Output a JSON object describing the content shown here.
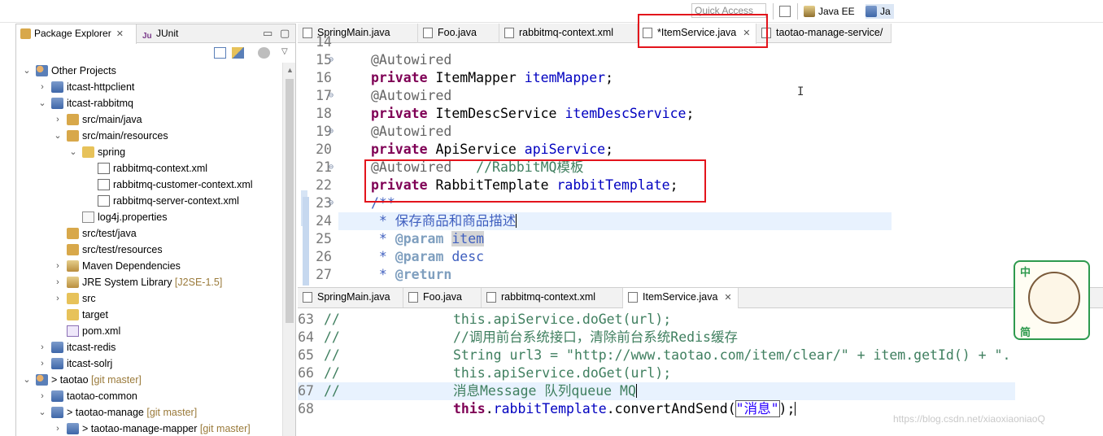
{
  "toolbar": {
    "quick_access": "Quick Access",
    "perspective_java_ee": "Java EE",
    "perspective_java": "Ja"
  },
  "explorer": {
    "tab_package_explorer": "Package Explorer",
    "tab_junit": "JUnit",
    "tree": [
      {
        "label": "Other Projects",
        "deco": "",
        "depth": 0,
        "twisty": "v",
        "icon": "people"
      },
      {
        "label": "itcast-httpclient",
        "deco": "",
        "depth": 1,
        "twisty": ">",
        "icon": "proj"
      },
      {
        "label": "itcast-rabbitmq",
        "deco": "",
        "depth": 1,
        "twisty": "v",
        "icon": "proj"
      },
      {
        "label": "src/main/java",
        "deco": "",
        "depth": 2,
        "twisty": ">",
        "icon": "pkgfolder"
      },
      {
        "label": "src/main/resources",
        "deco": "",
        "depth": 2,
        "twisty": "v",
        "icon": "pkgfolder"
      },
      {
        "label": "spring",
        "deco": "",
        "depth": 3,
        "twisty": "v",
        "icon": "folder"
      },
      {
        "label": "rabbitmq-context.xml",
        "deco": "",
        "depth": 4,
        "twisty": "",
        "icon": "xml"
      },
      {
        "label": "rabbitmq-customer-context.xml",
        "deco": "",
        "depth": 4,
        "twisty": "",
        "icon": "xml"
      },
      {
        "label": "rabbitmq-server-context.xml",
        "deco": "",
        "depth": 4,
        "twisty": "",
        "icon": "xml"
      },
      {
        "label": "log4j.properties",
        "deco": "",
        "depth": 3,
        "twisty": "",
        "icon": "file"
      },
      {
        "label": "src/test/java",
        "deco": "",
        "depth": 2,
        "twisty": "",
        "icon": "pkgfolder"
      },
      {
        "label": "src/test/resources",
        "deco": "",
        "depth": 2,
        "twisty": "",
        "icon": "pkgfolder"
      },
      {
        "label": "Maven Dependencies",
        "deco": "",
        "depth": 2,
        "twisty": ">",
        "icon": "lib"
      },
      {
        "label": "JRE System Library",
        "deco": " [J2SE-1.5]",
        "depth": 2,
        "twisty": ">",
        "icon": "lib"
      },
      {
        "label": "src",
        "deco": "",
        "depth": 2,
        "twisty": ">",
        "icon": "folder"
      },
      {
        "label": "target",
        "deco": "",
        "depth": 2,
        "twisty": "",
        "icon": "folder"
      },
      {
        "label": "pom.xml",
        "deco": "",
        "depth": 2,
        "twisty": "",
        "icon": "m"
      },
      {
        "label": "itcast-redis",
        "deco": "",
        "depth": 1,
        "twisty": ">",
        "icon": "proj"
      },
      {
        "label": "itcast-solrj",
        "deco": "",
        "depth": 1,
        "twisty": ">",
        "icon": "proj"
      },
      {
        "label": "> taotao",
        "deco": "  [git master]",
        "depth": 0,
        "twisty": "v",
        "icon": "people"
      },
      {
        "label": "taotao-common",
        "deco": "",
        "depth": 1,
        "twisty": ">",
        "icon": "proj"
      },
      {
        "label": "> taotao-manage",
        "deco": "  [git master]",
        "depth": 1,
        "twisty": "v",
        "icon": "proj"
      },
      {
        "label": "> taotao-manage-mapper",
        "deco": "  [git master]",
        "depth": 2,
        "twisty": ">",
        "icon": "proj"
      }
    ]
  },
  "editor_top": {
    "tabs": [
      "SpringMain.java",
      "Foo.java",
      "rabbitmq-context.xml",
      "*ItemService.java",
      "taotao-manage-service/"
    ],
    "active_tab": 3,
    "lines": [
      {
        "n": "14",
        "fold": false,
        "html": ""
      },
      {
        "n": "15",
        "fold": true,
        "html": "<span class=\"ann\">@Autowired</span>"
      },
      {
        "n": "16",
        "fold": false,
        "html": "<span class=\"kw\">private</span> ItemMapper <span class=\"fld\">itemMapper</span>;"
      },
      {
        "n": "17",
        "fold": true,
        "html": "<span class=\"ann\">@Autowired</span>"
      },
      {
        "n": "18",
        "fold": false,
        "html": "<span class=\"kw\">private</span> ItemDescService <span class=\"fld\">itemDescService</span>;"
      },
      {
        "n": "19",
        "fold": true,
        "html": "<span class=\"ann\">@Autowired</span>"
      },
      {
        "n": "20",
        "fold": false,
        "html": "<span class=\"kw\">private</span> ApiService <span class=\"fld\">apiService</span>;"
      },
      {
        "n": "21",
        "fold": true,
        "html": "<span class=\"ann\">@Autowired</span>   <span class=\"cm\">//RabbitMQ模板</span>"
      },
      {
        "n": "22",
        "fold": false,
        "html": "<span class=\"kw\">private</span> RabbitTemplate <span class=\"fld\">rabbitTemplate</span>;"
      },
      {
        "n": "23",
        "fold": true,
        "html": "<span class=\"jd\">/**</span>"
      },
      {
        "n": "24",
        "fold": false,
        "html": "<span class=\"jd\"> * 保存商品和商品描述</span><span class=\"caret\"></span>",
        "hl": true
      },
      {
        "n": "25",
        "fold": false,
        "html": "<span class=\"jd\"> * </span><span class=\"jdtag\">@param</span><span class=\"jd\"> </span><span class=\"jd occ\">item</span>"
      },
      {
        "n": "26",
        "fold": false,
        "html": "<span class=\"jd\"> * </span><span class=\"jdtag\">@param</span><span class=\"jd\"> desc</span>"
      },
      {
        "n": "27",
        "fold": false,
        "html": "<span class=\"jd\"> * </span><span class=\"jdtag\">@return</span>"
      }
    ]
  },
  "editor_bottom": {
    "tabs": [
      "SpringMain.java",
      "Foo.java",
      "rabbitmq-context.xml",
      "ItemService.java"
    ],
    "active_tab": 3,
    "lines": [
      {
        "n": "63",
        "html": "<span class=\"cm\">//              this.apiService.doGet(url);</span>"
      },
      {
        "n": "64",
        "html": "<span class=\"cm\">//              //调用前台系统接口，清除前台系统Redis缓存</span>"
      },
      {
        "n": "65",
        "html": "<span class=\"cm\">//              String url3 = \"http://www.taotao.com/item/clear/\" + item.getId() + \".</span>"
      },
      {
        "n": "66",
        "html": "<span class=\"cm\">//              this.apiService.doGet(url);</span>"
      },
      {
        "n": "67",
        "html": "<span class=\"cm\">//              消息Message 队列queue MQ</span><span class=\"caret\"></span>",
        "hl": true
      },
      {
        "n": "68",
        "html": "                <span class=\"kw\">this</span>.<span class=\"fld\">rabbitTemplate</span>.convertAndSend(<span class=\"str\" style=\"outline:1px solid #5a5a5a\">\"消息\"</span>);<span class=\"caret\"></span>"
      }
    ]
  },
  "mascot": {
    "top_char": "中",
    "bottom_char": "简"
  },
  "watermark": "https://blog.csdn.net/xiaoxiaoniaoQ"
}
